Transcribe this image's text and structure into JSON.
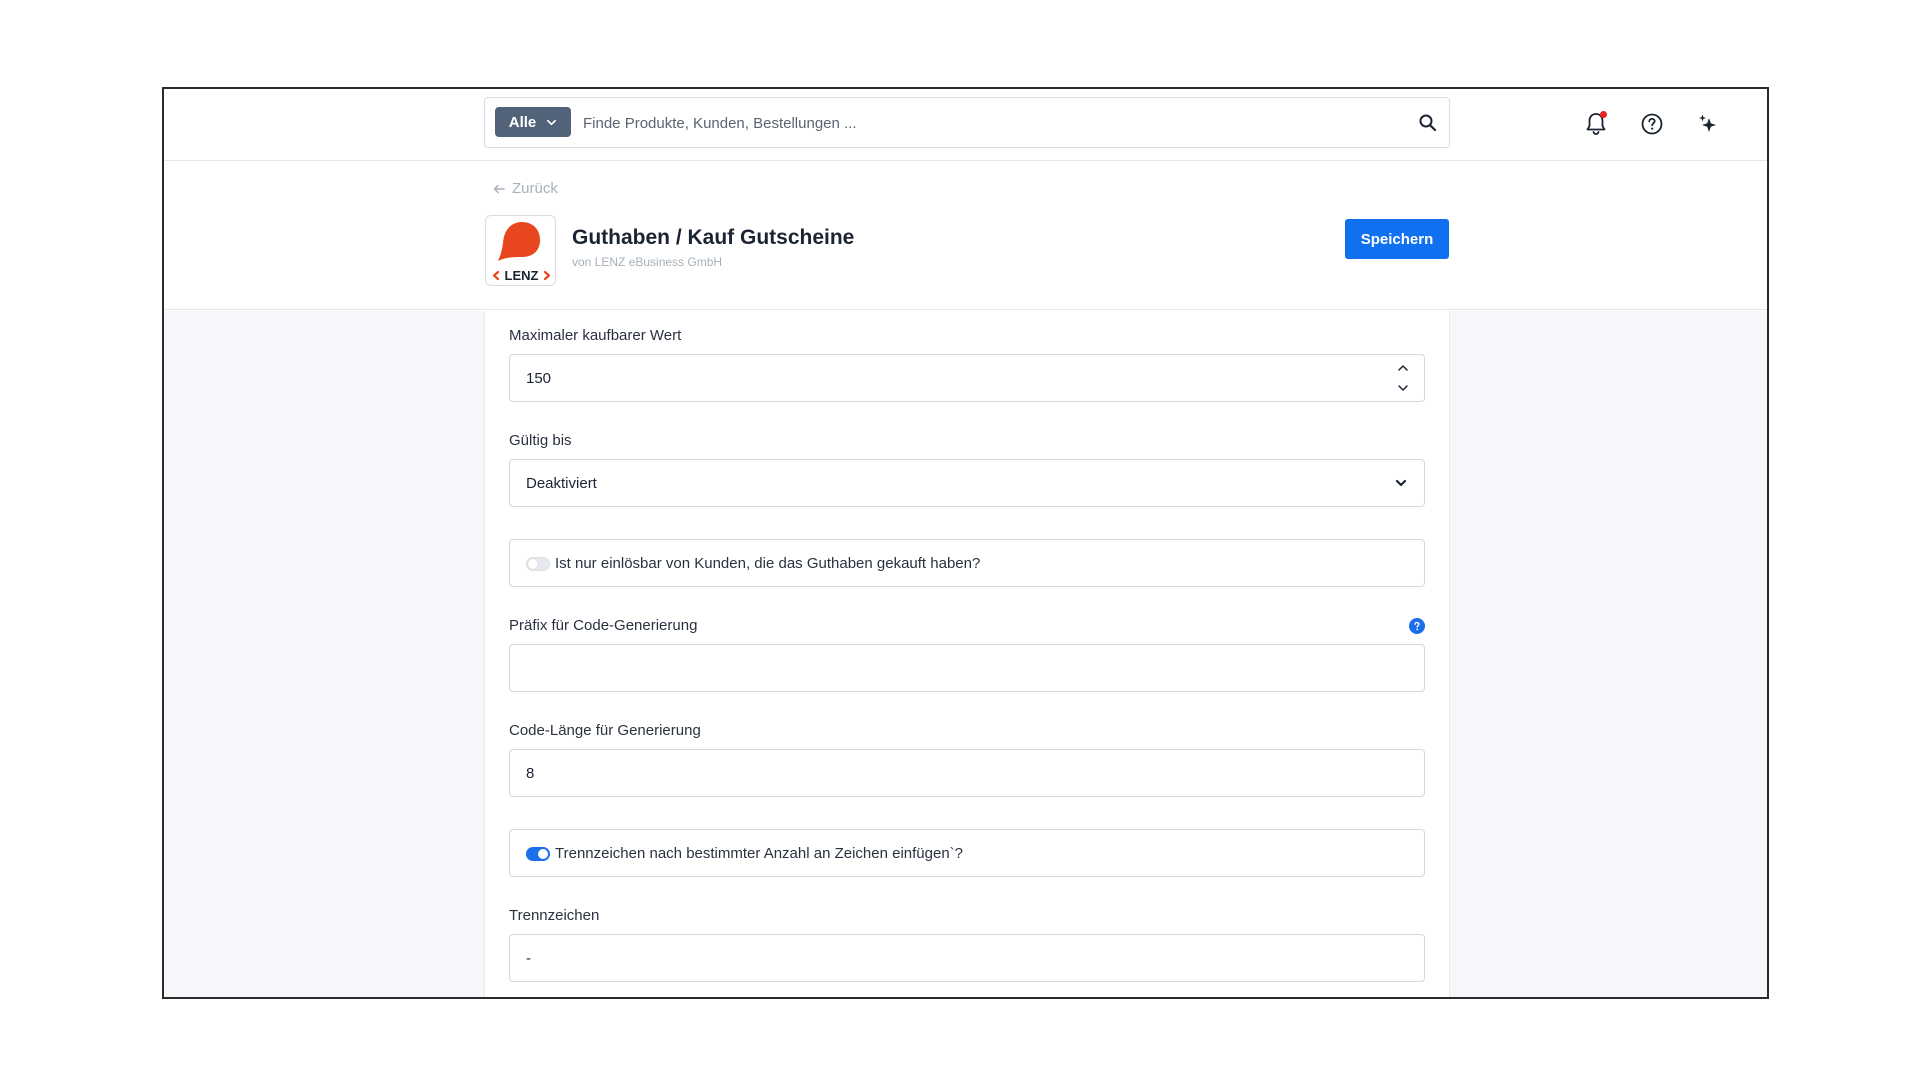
{
  "topbar": {
    "scope_label": "Alle",
    "search_placeholder": "Finde Produkte, Kunden, Bestellungen ..."
  },
  "header": {
    "back_label": "Zurück",
    "app_title": "Guthaben / Kauf Gutscheine",
    "app_vendor": "von LENZ eBusiness GmbH",
    "logo_text": "LENZ",
    "save_label": "Speichern"
  },
  "form": {
    "max_value": {
      "label": "Maximaler kaufbarer Wert",
      "value": "150"
    },
    "valid_until": {
      "label": "Gültig bis",
      "value": "Deaktiviert"
    },
    "only_buyer": {
      "label": "Ist nur einlösbar von Kunden, die das Guthaben gekauft haben?",
      "enabled": false
    },
    "prefix": {
      "label": "Präfix für Code-Generierung",
      "value": ""
    },
    "code_length": {
      "label": "Code-Länge für Generierung",
      "value": "8"
    },
    "separator_toggle": {
      "label": "Trennzeichen nach bestimmter Anzahl an Zeichen einfügen`?",
      "enabled": true
    },
    "separator": {
      "label": "Trennzeichen",
      "value": "-"
    }
  },
  "colors": {
    "primary": "#0f70f0",
    "scope_button": "#526379",
    "logo_red": "#e8461e",
    "notification": "#e5231f"
  }
}
